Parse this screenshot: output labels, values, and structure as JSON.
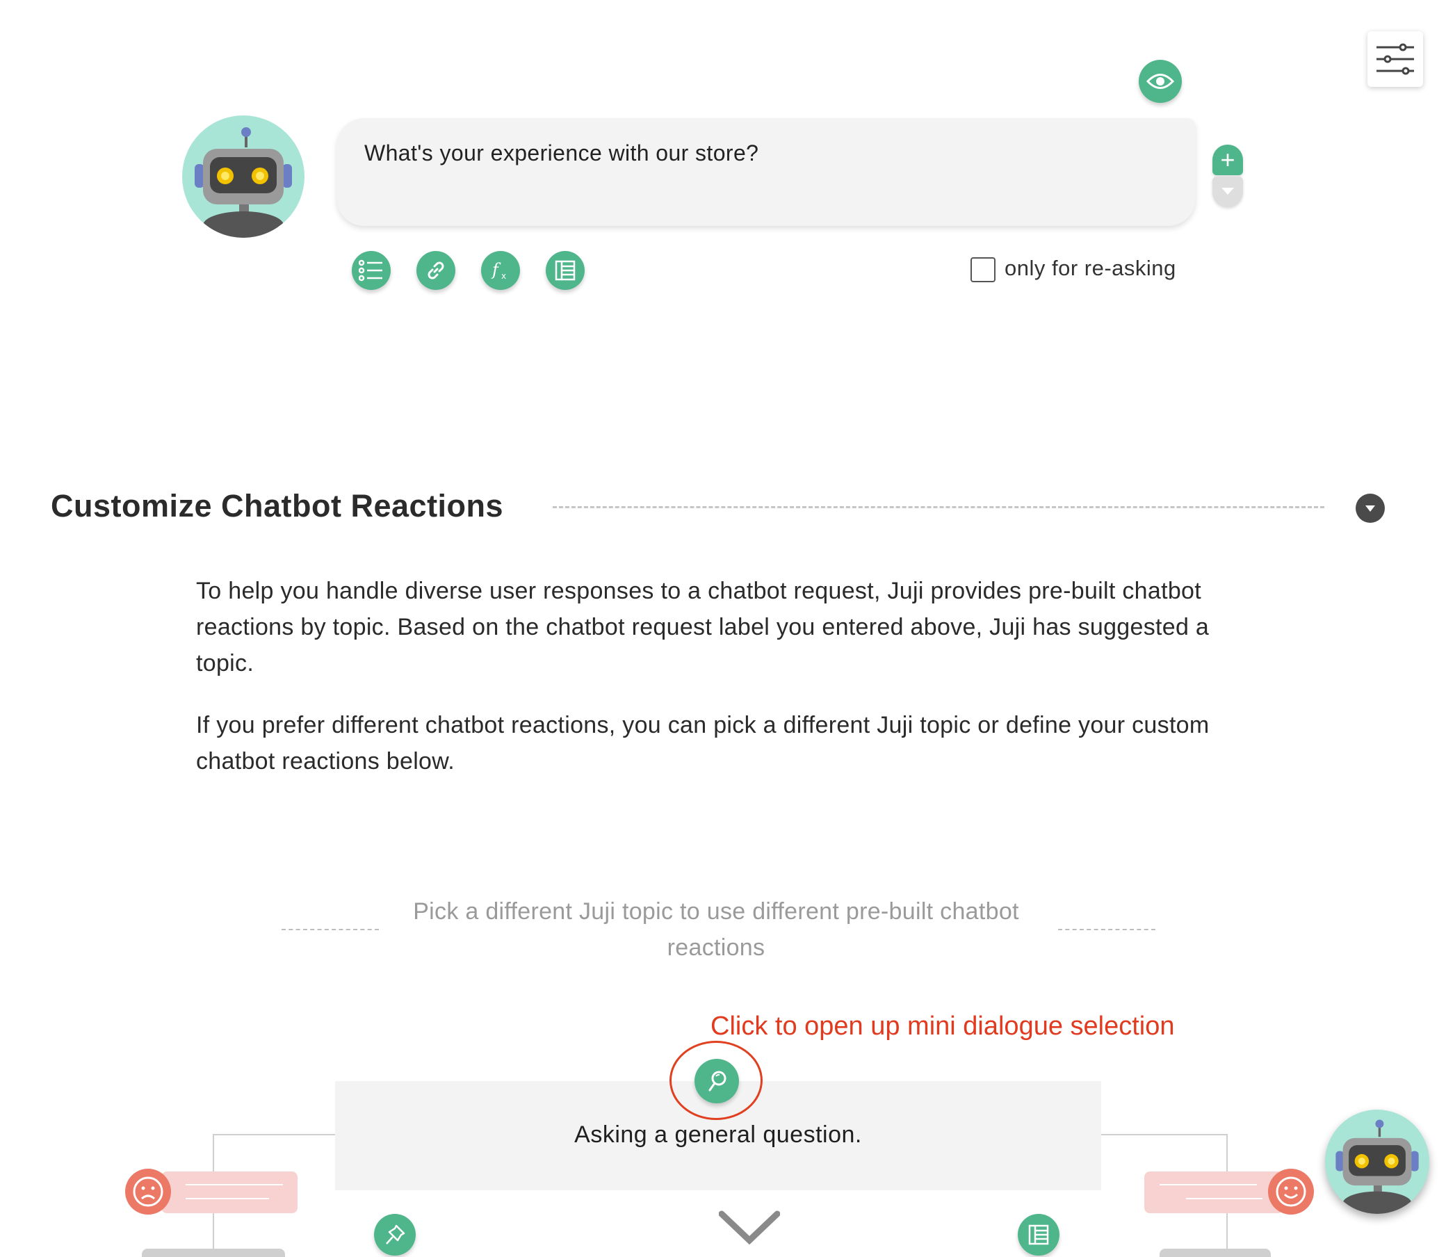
{
  "header": {
    "settings_icon": "sliders-icon",
    "preview_icon": "eye-icon"
  },
  "question": {
    "text": "What's your experience with our store?",
    "add_icon": "plus-icon",
    "more_icon": "caret-down-icon",
    "toolbar_icons": [
      "list-icon",
      "link-icon",
      "function-icon",
      "table-icon"
    ],
    "reask_label": "only for re-asking",
    "reask_checked": false
  },
  "section": {
    "title": "Customize Chatbot Reactions",
    "collapse_icon": "caret-down-icon",
    "paragraph1": "To help you handle diverse user responses to a chatbot request, Juji provides pre-built chatbot reactions by topic. Based on the chatbot request label you entered above, Juji has suggested a topic.",
    "paragraph2": "If you prefer different chatbot reactions, you can pick a different Juji topic or define your custom chatbot reactions below."
  },
  "topic": {
    "pick_label": "Pick a different Juji topic to use different pre-built chatbot reactions",
    "annotation": "Click to open up mini dialogue selection",
    "search_icon": "search-icon",
    "current_topic": "Asking a general question.",
    "pin_icon": "pin-icon",
    "table_icon": "table-icon",
    "expand_icon": "chevron-down-icon",
    "negative_icon": "sad-face-icon",
    "positive_icon": "happy-face-icon"
  },
  "colors": {
    "accent_green": "#4fb58b",
    "annotation_red": "#e23a1e",
    "reaction_red": "#ec7866",
    "bubble_pink": "#f8d2d0"
  }
}
